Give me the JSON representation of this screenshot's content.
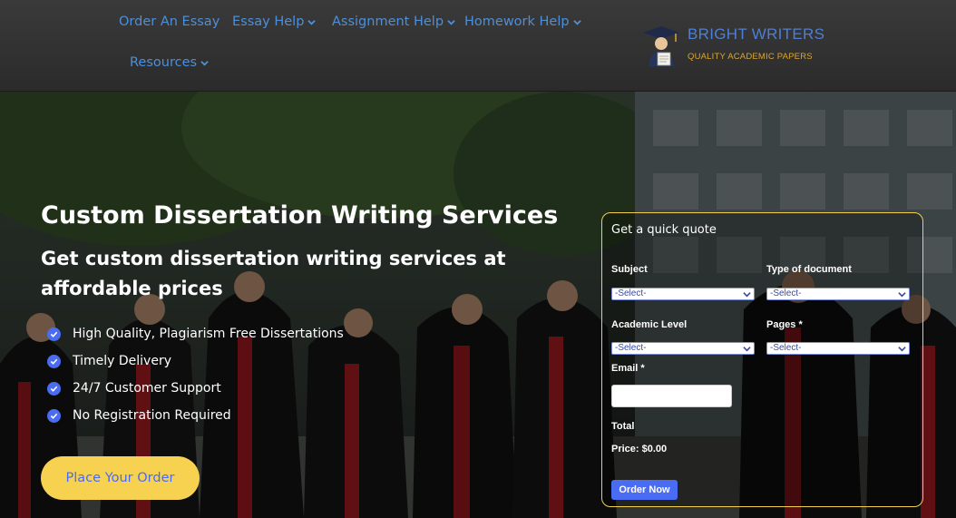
{
  "nav": {
    "items": [
      {
        "label": "Order An Essay",
        "has_dropdown": false
      },
      {
        "label": "Essay Help",
        "has_dropdown": true
      },
      {
        "label": "Assignment Help",
        "has_dropdown": true
      },
      {
        "label": "Homework Help",
        "has_dropdown": true
      },
      {
        "label": "Resources",
        "has_dropdown": true
      }
    ]
  },
  "logo": {
    "title": "BRIGHT WRITERS",
    "tagline": "QUALITY ACADEMIC PAPERS",
    "icon": "graduate-icon"
  },
  "hero": {
    "title": "Custom Dissertation Writing Services",
    "subtitle": "Get custom dissertation writing services at affordable prices",
    "features": [
      "High Quality, Plagiarism Free Dissertations",
      "Timely Delivery",
      "24/7 Customer Support",
      "No Registration Required"
    ],
    "cta_label": "Place Your Order"
  },
  "quote": {
    "title": "Get a quick quote",
    "subject_label": "Subject",
    "subject_value": "-Select-",
    "doc_type_label": "Type of document",
    "doc_type_value": "-Select-",
    "level_label": "Academic Level",
    "level_value": "-Select-",
    "pages_label": "Pages *",
    "pages_value": "-Select-",
    "email_label": "Email *",
    "email_value": "",
    "total_label": "Total",
    "price_label": "Price:",
    "price_value": "$0.00",
    "submit_label": "Order Now"
  },
  "colors": {
    "accent_blue": "#4a6cf2",
    "nav_link": "#4d8fd8",
    "cta_yellow": "#f7d251",
    "form_border": "#f2d04a"
  }
}
